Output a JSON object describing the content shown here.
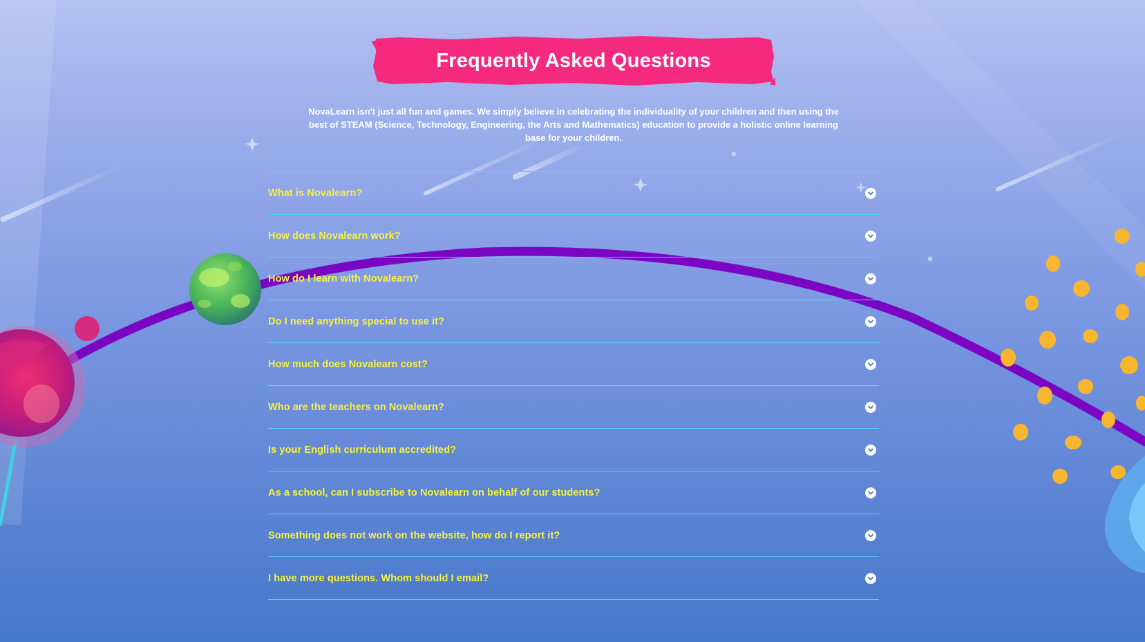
{
  "page": {
    "title": "Frequently Asked Questions",
    "intro": "NovaLearn isn't just all fun and games. We simply believe in celebrating the individuality of your children and then using the best of STEAM (Science, Technology, Engineering, the Arts and Mathematics) education to provide a holistic online learning base for your children."
  },
  "faq": {
    "items": [
      {
        "question": "What is Novalearn?"
      },
      {
        "question": "How does Novalearn work?"
      },
      {
        "question": "How do I learn with Novalearn?"
      },
      {
        "question": "Do I need anything special to use it?"
      },
      {
        "question": "How much does Novalearn cost?"
      },
      {
        "question": "Who are the teachers on Novalearn?"
      },
      {
        "question": "Is your English curriculum accredited?"
      },
      {
        "question": "As a school, can I subscribe to Novalearn on behalf of our students?"
      },
      {
        "question": "Something does not work on the website, how do I report it?"
      },
      {
        "question": "I have more questions. Whom should I email?"
      }
    ],
    "expand_icon": "chevron-down-icon"
  },
  "theme": {
    "banner_color": "#f52a7f",
    "question_color": "#f7f23c",
    "divider_color": "#4fd8f2",
    "orbit_color": "#7a06c4",
    "dot_color": "#f8b52f"
  }
}
